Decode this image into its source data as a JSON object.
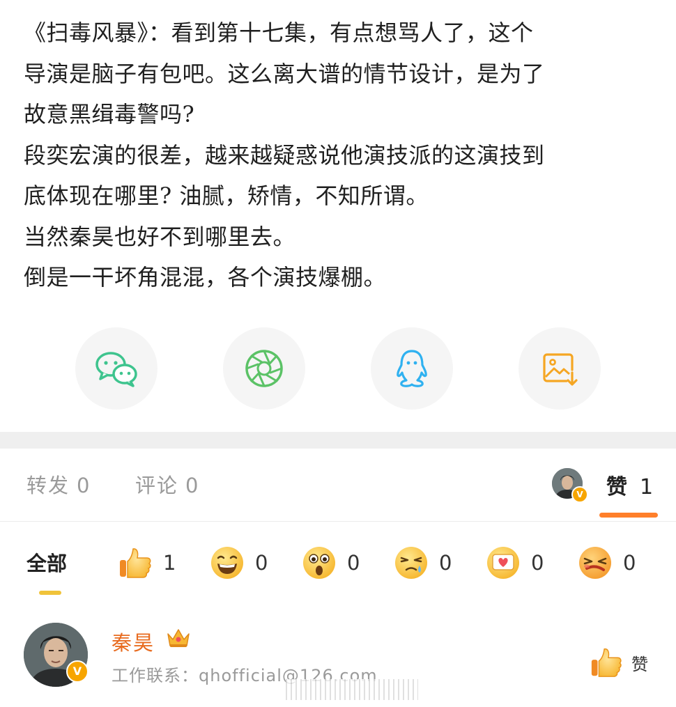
{
  "post": {
    "lines": [
      "《扫毒风暴》：看到第十七集，有点想骂人了，这个",
      "导演是脑子有包吧。这么离大谱的情节设计，是为了",
      "故意黑缉毒警吗?",
      "段奕宏演的很差，越来越疑惑说他演技派的这演技到",
      "底体现在哪里? 油腻，矫情，不知所谓。",
      "当然秦昊也好不到哪里去。",
      "倒是一干坏角混混，各个演技爆棚。"
    ]
  },
  "share": {
    "buttons": [
      {
        "icon": "wechat-icon",
        "color": "#3ec48e"
      },
      {
        "icon": "moments-icon",
        "color": "#5bc266"
      },
      {
        "icon": "qq-icon",
        "color": "#2fb1f0"
      },
      {
        "icon": "save-image-icon",
        "color": "#f5a623"
      }
    ]
  },
  "stats": {
    "repost_label": "转发",
    "repost_count": "0",
    "comment_label": "评论",
    "comment_count": "0",
    "like_label": "赞",
    "like_count": "1",
    "accent": "#ff7f2a"
  },
  "filters": {
    "all_label": "全部",
    "reactions": [
      {
        "icon": "thumbs-up-emoji-icon",
        "count": "1"
      },
      {
        "icon": "laughing-emoji-icon",
        "count": "0"
      },
      {
        "icon": "surprised-emoji-icon",
        "count": "0"
      },
      {
        "icon": "crying-emoji-icon",
        "count": "0"
      },
      {
        "icon": "heart-emoji-icon",
        "count": "0"
      },
      {
        "icon": "angry-emoji-icon",
        "count": "0"
      }
    ]
  },
  "liker": {
    "name": "秦昊",
    "description": "工作联系：qhofficial@126.com",
    "verified_badge": "V",
    "like_label": "赞",
    "name_color": "#e86b1f"
  }
}
